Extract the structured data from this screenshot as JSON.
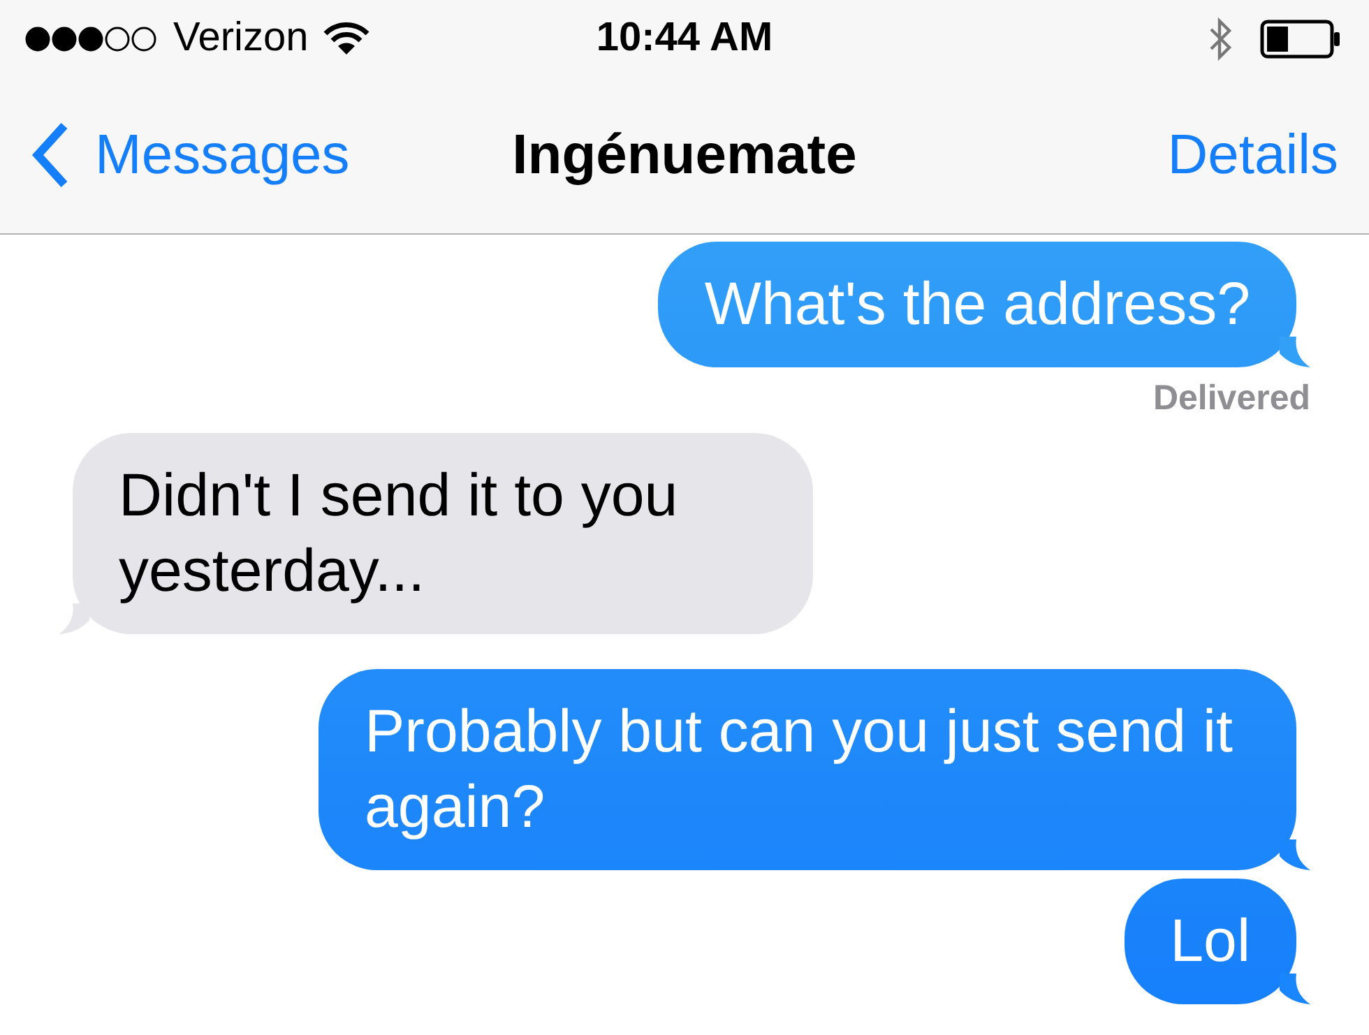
{
  "status_bar": {
    "carrier": "Verizon",
    "time": "10:44 AM"
  },
  "nav_bar": {
    "back": "Messages",
    "title": "Ingénuemate",
    "action": "Details"
  },
  "messages": [
    {
      "kind": "outgoing",
      "text": "What's the address?",
      "status": "Delivered"
    },
    {
      "kind": "incoming",
      "text": "Didn't I send it to you yesterday..."
    },
    {
      "kind": "outgoing",
      "text": "Probably but can you just send it again?"
    },
    {
      "kind": "outgoing",
      "text": "Lol"
    }
  ]
}
